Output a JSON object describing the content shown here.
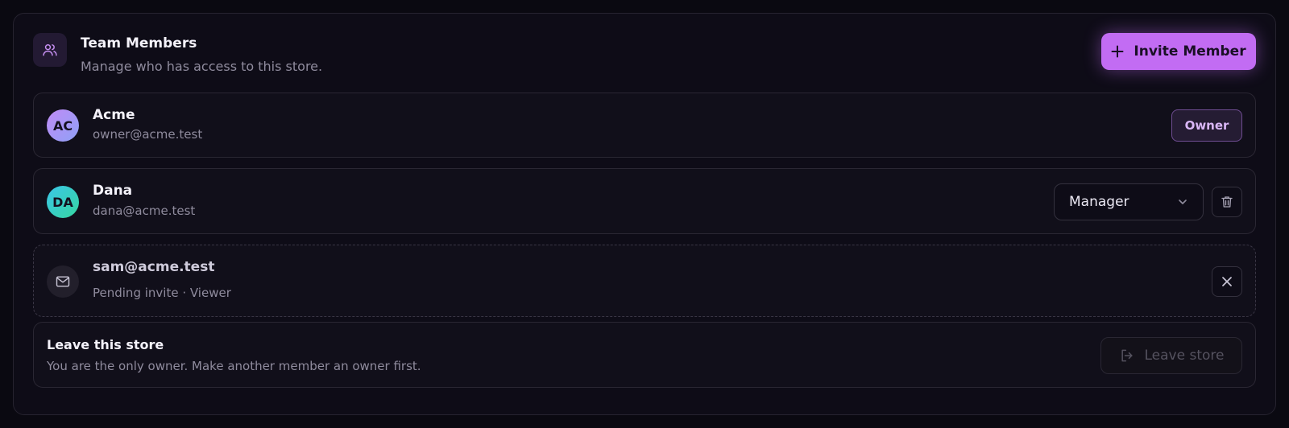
{
  "header": {
    "title": "Team Members",
    "subtitle": "Manage who has access to this store.",
    "invite_label": "Invite Member"
  },
  "members": [
    {
      "initials": "AC",
      "name": "Acme",
      "email": "owner@acme.test",
      "role_badge": "Owner"
    },
    {
      "initials": "DA",
      "name": "Dana",
      "email": "dana@acme.test",
      "role_select": "Manager"
    }
  ],
  "pending": {
    "email": "sam@acme.test",
    "status": "Pending invite · Viewer"
  },
  "leave": {
    "title": "Leave this store",
    "description": "You are the only owner. Make another member an owner first.",
    "button_label": "Leave store"
  },
  "colors": {
    "accent": "#c26cf3",
    "background": "#0a0911",
    "panel": "#0e0c17"
  },
  "icons": {
    "header": "users-icon",
    "invite": "plus-icon",
    "select": "chevron-down-icon",
    "delete": "trash-icon",
    "pending": "mail-icon",
    "revoke": "close-icon",
    "leave": "log-out-icon"
  }
}
